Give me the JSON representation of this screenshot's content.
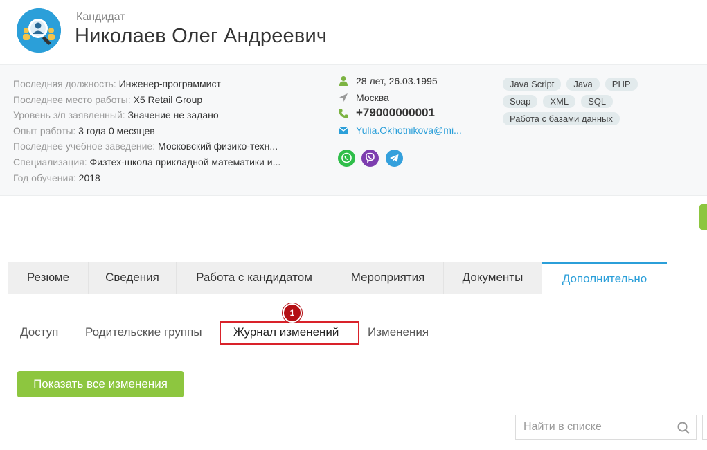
{
  "header": {
    "kind": "Кандидат",
    "full_name": "Николаев Олег Андреевич"
  },
  "info": {
    "rows": [
      {
        "label": "Последняя должность:",
        "value": "Инженер-программист"
      },
      {
        "label": "Последнее место работы:",
        "value": "X5 Retail Group"
      },
      {
        "label": "Уровень з/п заявленный:",
        "value": "Значение не задано"
      },
      {
        "label": "Опыт работы:",
        "value": "3 года 0 месяцев"
      },
      {
        "label": "Последнее учебное заведение:",
        "value": "Московский физико-техн..."
      },
      {
        "label": "Специализация:",
        "value": "Физтех-школа прикладной математики и..."
      },
      {
        "label": "Год обучения:",
        "value": "2018"
      }
    ]
  },
  "contacts": {
    "age_birth": "28 лет, 26.03.1995",
    "city": "Москва",
    "phone": "+79000000001",
    "email": "Yulia.Okhotnikova@mi..."
  },
  "messengers": [
    "whatsapp-icon",
    "viber-icon",
    "telegram-icon"
  ],
  "tags": [
    "Java Script",
    "Java",
    "PHP",
    "Soap",
    "XML",
    "SQL",
    "Работа с базами данных"
  ],
  "main_tabs": [
    "Резюме",
    "Сведения",
    "Работа с кандидатом",
    "Мероприятия",
    "Документы",
    "Дополнительно"
  ],
  "sub_tabs": [
    "Доступ",
    "Родительские группы",
    "Журнал изменений",
    "Изменения"
  ],
  "marker": "1",
  "show_all_button": "Показать все изменения",
  "search": {
    "placeholder": "Найти в списке"
  },
  "colors": {
    "accent": "#2b9fd9",
    "green": "#8dc63f",
    "highlight": "#d9222a"
  }
}
